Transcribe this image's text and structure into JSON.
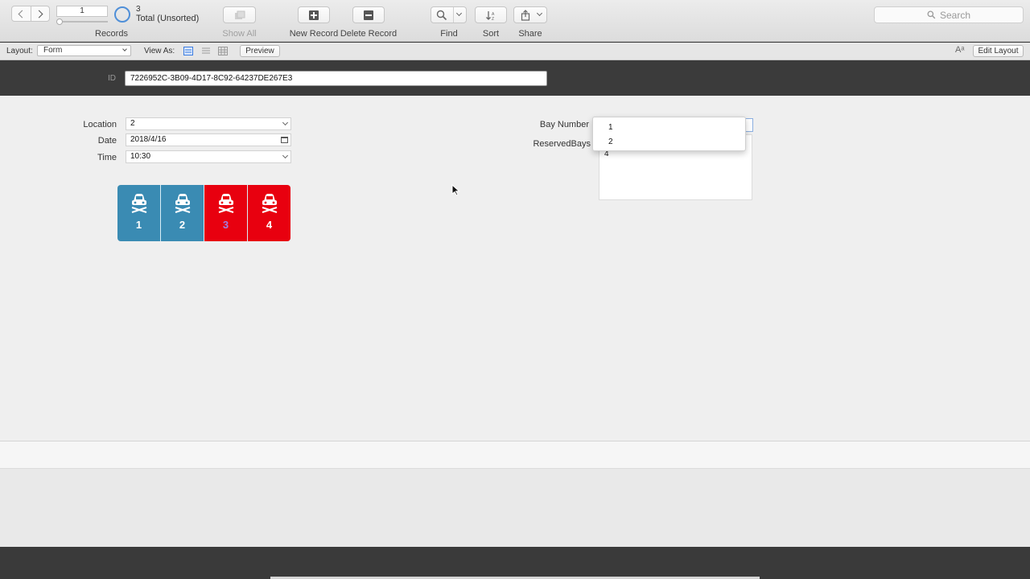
{
  "toolbar": {
    "record_current": "1",
    "record_count": "3",
    "record_status": "Total (Unsorted)",
    "records_label": "Records",
    "show_all_label": "Show All",
    "new_record_label": "New Record",
    "delete_record_label": "Delete Record",
    "find_label": "Find",
    "sort_label": "Sort",
    "share_label": "Share",
    "search_placeholder": "Search",
    "accent_color": "#4f8fd8"
  },
  "layoutbar": {
    "layout_label": "Layout:",
    "layout_value": "Form",
    "view_as_label": "View As:",
    "preview_label": "Preview",
    "font_icon_text": "Aᵃ",
    "edit_layout_label": "Edit Layout"
  },
  "header": {
    "id_label": "ID",
    "id_value": "7226952C-3B09-4D17-8C92-64237DE267E3"
  },
  "form": {
    "location_label": "Location",
    "location_value": "2",
    "date_label": "Date",
    "date_value": "2018/4/16",
    "time_label": "Time",
    "time_value": "10:30",
    "bay_number_label": "Bay Number",
    "reserved_bays_label": "ReservedBays",
    "reserved_bays_value": "4",
    "bay_dropdown_options": [
      "1",
      "2"
    ]
  },
  "bays": [
    {
      "number": "1",
      "status": "available",
      "color": "#3a8bb3"
    },
    {
      "number": "2",
      "status": "available",
      "color": "#3a8bb3"
    },
    {
      "number": "3",
      "status": "reserved",
      "color": "#e8000f",
      "number_color": "#9f7fe0"
    },
    {
      "number": "4",
      "status": "reserved",
      "color": "#e8000f"
    }
  ]
}
